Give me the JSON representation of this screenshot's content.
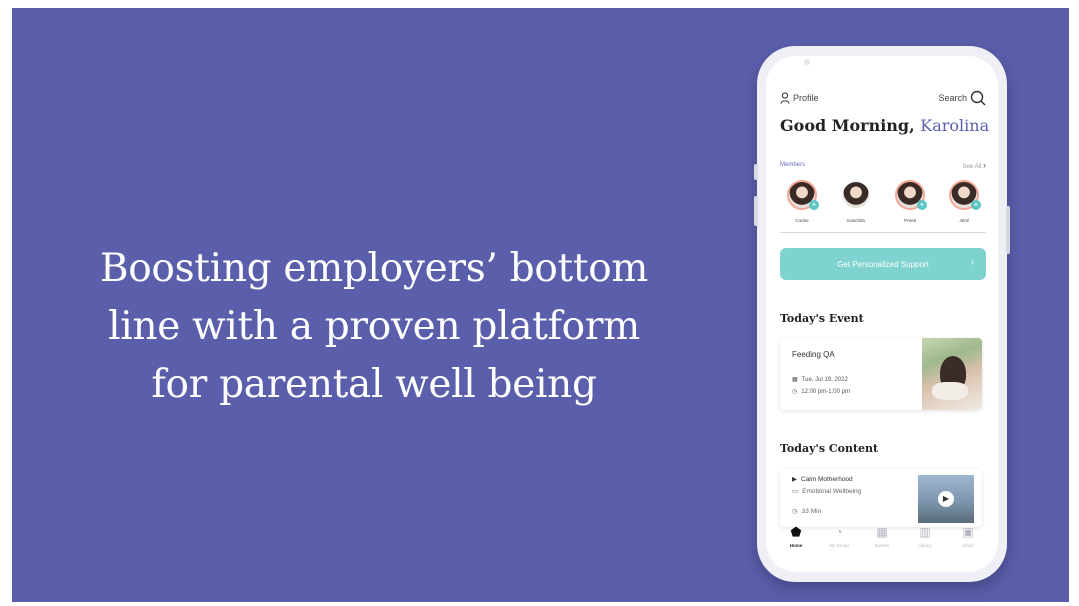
{
  "headline": {
    "line1": "Boosting employers’ bottom",
    "line2": "line with a proven platform",
    "line3": "for parental well being"
  },
  "colors": {
    "background": "#5b5eab",
    "accent": "#5b5eab",
    "teal": "#7fd3cf"
  },
  "app": {
    "topbar": {
      "profile_label": "Profile",
      "search_label": "Search"
    },
    "greeting": {
      "prefix": "Good Morning,",
      "name": "Karolina"
    },
    "members": {
      "heading": "Members",
      "see_all": "See All",
      "items": [
        {
          "name": "Corine",
          "has_plus": true
        },
        {
          "name": "Kanchita",
          "has_plus": false
        },
        {
          "name": "Preeti",
          "has_plus": true
        },
        {
          "name": "Jenil",
          "has_plus": true
        }
      ]
    },
    "support_button": "Get Personalized Support",
    "todays_event": {
      "title": "Today's Event",
      "event_name": "Feeding QA",
      "date": "Tue, Jul 19, 2022",
      "time": "12:00 pm-1:00 pm"
    },
    "todays_content": {
      "title": "Today's Content",
      "item_title": "Calm Motherhood",
      "category": "Emotional Wellbeing",
      "duration": "33 Min"
    },
    "tabs": [
      {
        "label": "Home",
        "icon": "home-icon",
        "active": true
      },
      {
        "label": "My Group",
        "icon": "group-icon",
        "active": false
      },
      {
        "label": "Events",
        "icon": "calendar-icon",
        "active": false
      },
      {
        "label": "Library",
        "icon": "map-icon",
        "active": false
      },
      {
        "label": "Inbox",
        "icon": "inbox-icon",
        "active": false
      }
    ]
  }
}
